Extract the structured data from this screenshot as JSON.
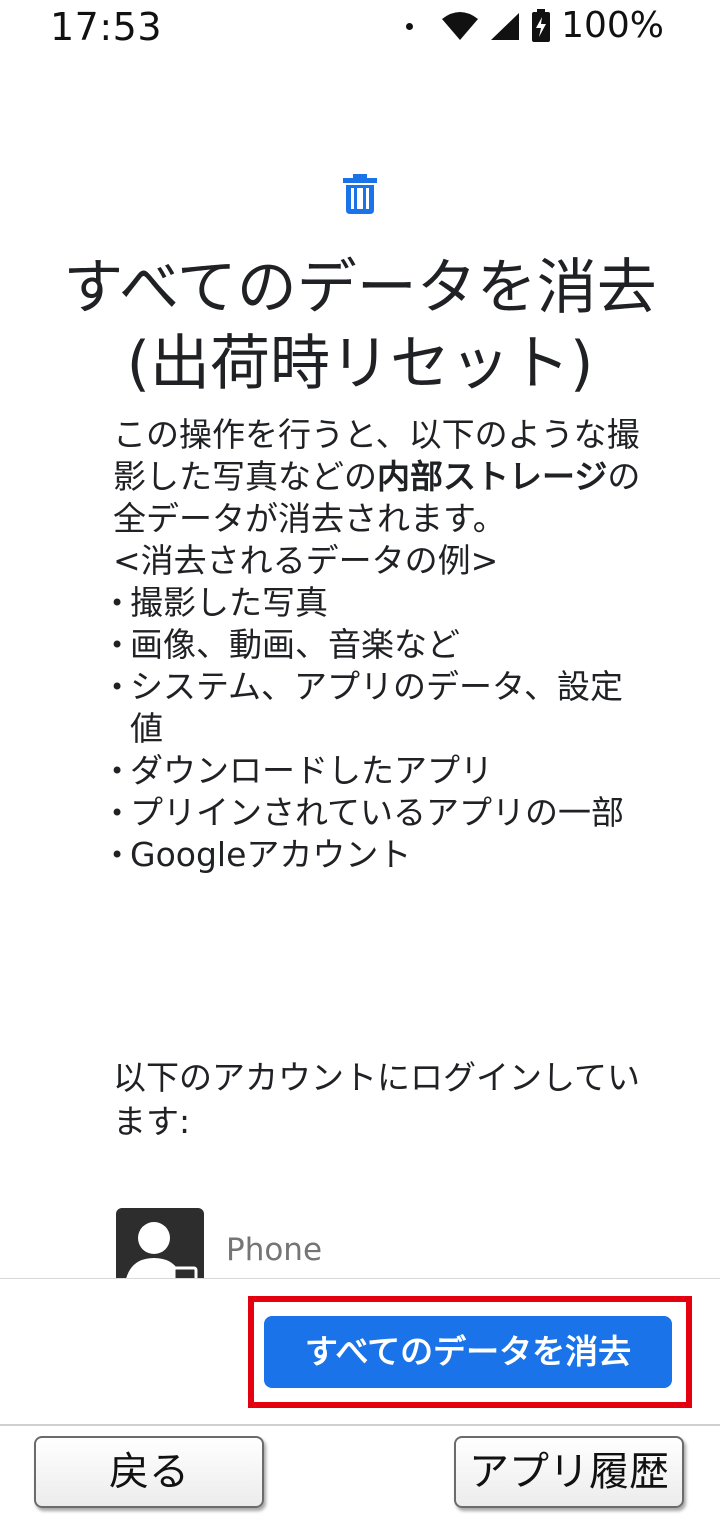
{
  "status_bar": {
    "time": "17:53",
    "battery": "100%",
    "icons": [
      "notification-dot-icon",
      "wifi-icon",
      "signal-icon",
      "battery-charging-icon"
    ]
  },
  "page": {
    "icon": "trash-icon",
    "title_line1": "すべてのデータを消去",
    "title_line2": "(出荷時リセット)",
    "intro_prefix": "この操作を行うと、以下のような撮影した写真などの",
    "intro_bold": "内部ストレージ",
    "intro_suffix": "の全データが消去されます。",
    "examples_header": "<消去されるデータの例>",
    "examples": [
      "撮影した写真",
      "画像、動画、音楽など",
      "システム、アプリのデータ、設定値",
      "ダウンロードしたアプリ",
      "プリインされているアプリの一部",
      "Googleアカウント"
    ],
    "accounts_intro": "以下のアカウントにログインしています:",
    "account_name": "Phone"
  },
  "actions": {
    "erase_all": "すべてのデータを消去"
  },
  "nav": {
    "back": "戻る",
    "app_history": "アプリ履歴"
  },
  "colors": {
    "accent": "#1a73e8",
    "highlight": "#e4000f"
  }
}
